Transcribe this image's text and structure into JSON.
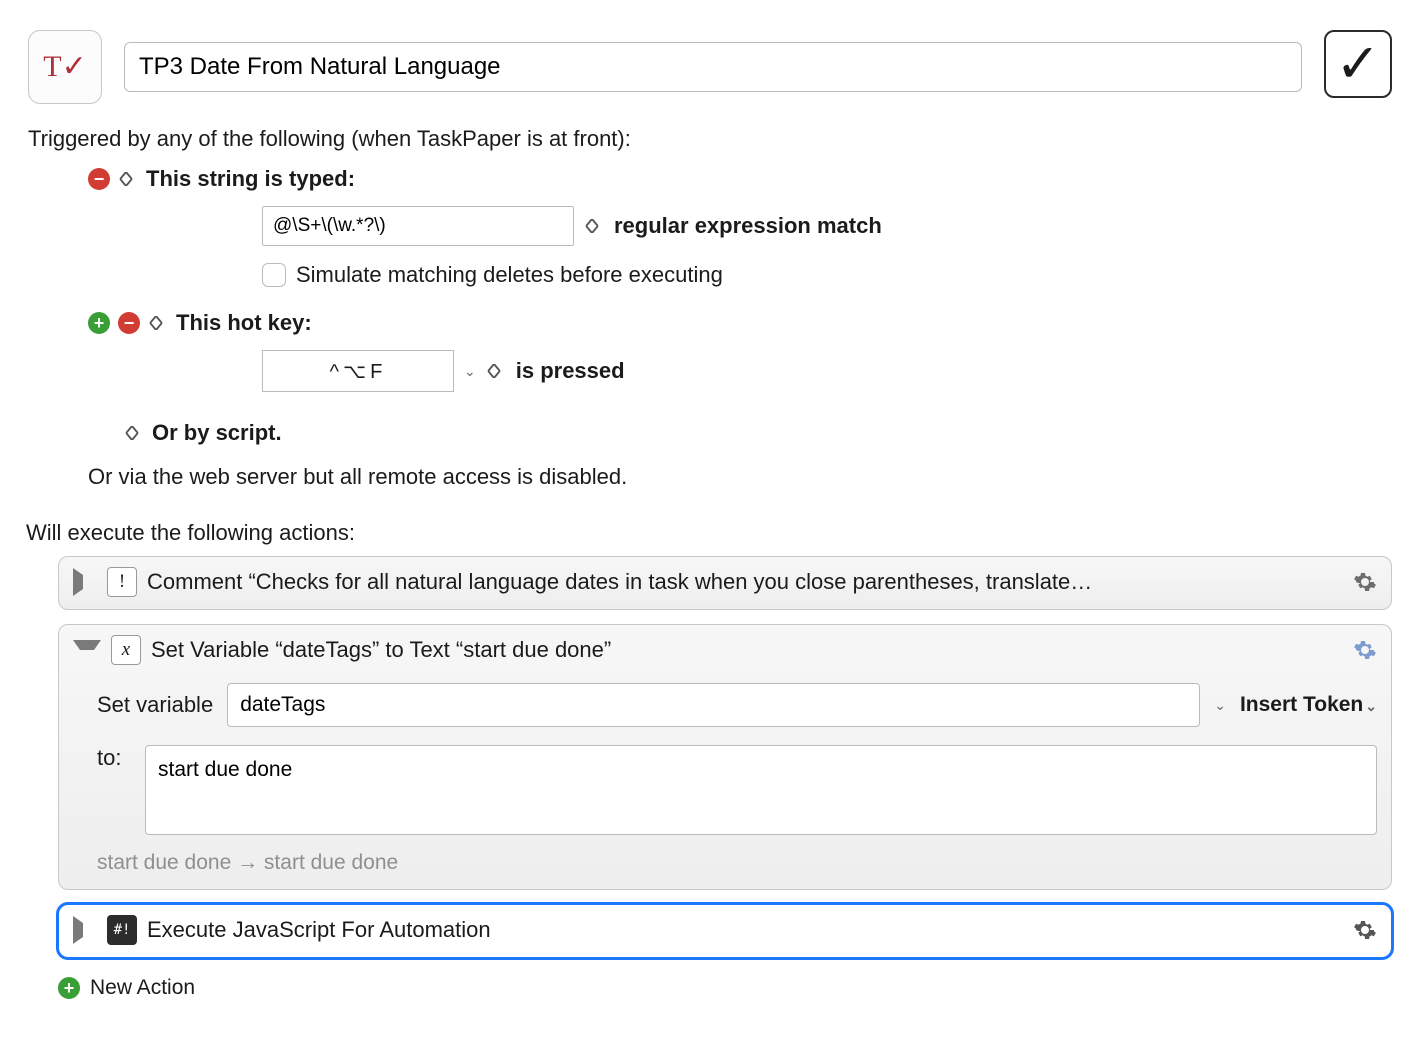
{
  "header": {
    "macro_name": "TP3 Date From Natural Language",
    "app_icon_glyph": "T✓",
    "enabled_glyph": "✓"
  },
  "triggers": {
    "intro": "Triggered by any of the following (when TaskPaper is at front):",
    "string_typed_label": "This string is typed:",
    "regex_value": "@\\S+\\(\\w.*?\\)",
    "regex_match_label": "regular expression match",
    "simulate_label": "Simulate matching deletes before executing",
    "hotkey_label": "This hot key:",
    "hotkey_value": "^⌥F",
    "is_pressed_label": "is pressed",
    "or_script_label": "Or by script.",
    "web_server_label": "Or via the web server but all remote access is disabled."
  },
  "actions_intro": "Will execute the following actions:",
  "actions": {
    "comment_title": "Comment “Checks for all natural language dates in task when you close parentheses, translate…",
    "setvar_title": "Set Variable “dateTags” to Text “start due done”",
    "setvar": {
      "label": "Set variable",
      "name": "dateTags",
      "insert_token": "Insert Token",
      "to_label": "to:",
      "to_value": "start due done",
      "preview": "start due done → start due done"
    },
    "jxa_title": "Execute JavaScript For Automation"
  },
  "new_action_label": "New Action"
}
